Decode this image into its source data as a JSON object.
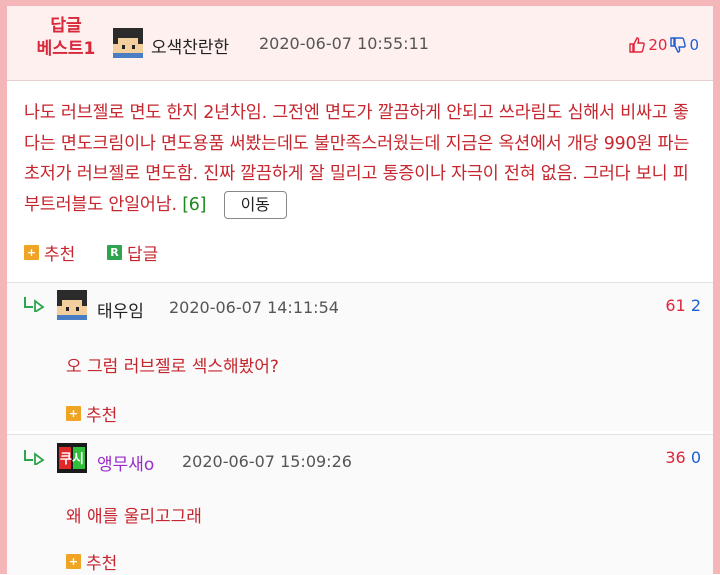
{
  "best": {
    "line1": "답글",
    "line2": "베스트1"
  },
  "post": {
    "author": "오색찬란한",
    "date": "2020-06-07 10:55:11",
    "up": "20",
    "down": "0",
    "text": "나도 러브젤로 면도 한지 2년차임. 그전엔 면도가 깔끔하게 안되고 쓰라림도 심해서 비싸고 좋다는 면도크림이나 면도용품 써봤는데도 불만족스러웠는데 지금은 옥션에서 개당 990원 파는 초저가 러브젤로 면도함. 진짜 깔끔하게 잘 밀리고 통증이나 자극이 전혀 없음. 그러다 보니 피부트러블도 안일어남.",
    "ref": "[6]",
    "move_label": "이동",
    "recommend_label": "추천",
    "reply_label": "답글"
  },
  "comments": [
    {
      "author": "태우임",
      "date": "2020-06-07 14:11:54",
      "up": "61",
      "down": "2",
      "text": "오 그럼 러브젤로 섹스해봤어?",
      "recommend_label": "추천"
    },
    {
      "author": "앵무새o",
      "date": "2020-06-07 15:09:26",
      "up": "36",
      "down": "0",
      "text": "왜 애를 울리고그래",
      "recommend_label": "추천",
      "avatar_text": "쿠시"
    }
  ],
  "colors": {
    "accent_red": "#c6262e",
    "up": "#e0243b",
    "down": "#1d5fd0",
    "border": "#f4b6b9"
  }
}
